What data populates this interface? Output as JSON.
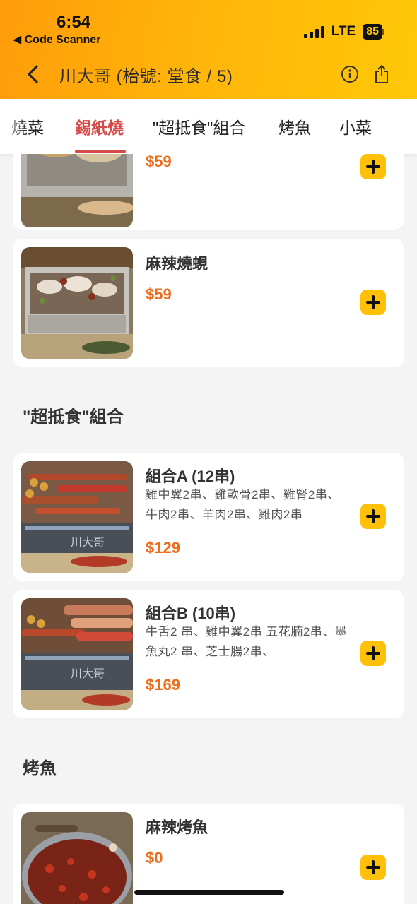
{
  "status_bar": {
    "time": "6:54",
    "back_app": "◀ Code Scanner",
    "network": "LTE",
    "battery": "85"
  },
  "nav": {
    "title": "川大哥 (枱號: 堂食 / 5)",
    "icons": [
      "chevron-left-icon",
      "info-icon",
      "share-icon"
    ]
  },
  "tabs": [
    {
      "label": "燒菜",
      "active": false
    },
    {
      "label": "錫紙燒",
      "active": true
    },
    {
      "label": "\"超抵食\"組合",
      "active": false
    },
    {
      "label": "烤魚",
      "active": false
    },
    {
      "label": "小菜",
      "active": false
    }
  ],
  "menu": {
    "item_top_partial": {
      "price": "$59"
    },
    "item_mala_clams": {
      "name": "麻辣燒蜆",
      "price": "$59"
    },
    "section_combo": "\"超抵食\"組合",
    "combo_a": {
      "name": "組合A (12串)",
      "desc": "雞中翼2串、雞軟骨2串、雞腎2串、牛肉2串、羊肉2串、雞肉2串",
      "price": "$129"
    },
    "combo_b": {
      "name": "組合B (10串)",
      "desc": "牛舌2 串、雞中翼2串 五花腩2串、墨魚丸2 串、芝士腸2串、",
      "price": "$169"
    },
    "section_fish": "烤魚",
    "mala_fish": {
      "name": "麻辣烤魚",
      "price": "$0"
    }
  },
  "colors": {
    "header_gradient_start": "#ff9c0a",
    "header_gradient_end": "#ffc808",
    "active_tab": "#d64a48",
    "price": "#ef6c1a",
    "add_button": "#ffc107"
  }
}
